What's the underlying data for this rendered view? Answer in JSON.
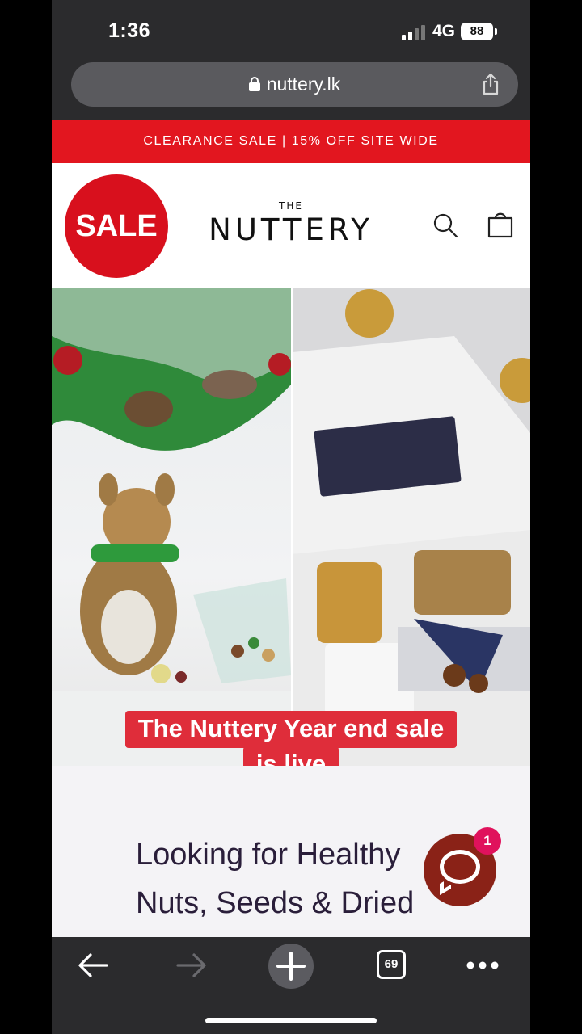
{
  "status_bar": {
    "time": "1:36",
    "network": "4G",
    "battery": "88"
  },
  "browser": {
    "url": "nuttery.lk"
  },
  "site": {
    "announcement": "CLEARANCE SALE | 15% OFF SITE WIDE",
    "sale_badge": "SALE",
    "logo_small": "THE",
    "logo_main": "NUTTERY",
    "hero_caption_line1": "The Nuttery Year end sale",
    "hero_caption_line2": "is live",
    "intro_title": "Looking for Healthy Nuts, Seeds & Dried Fruits?",
    "chat_unread": "1"
  },
  "toolbar": {
    "tabs_count": "69"
  },
  "colors": {
    "accent_red": "#e2161f",
    "caption_red": "#df2d3a",
    "chat_brown": "#8a2217",
    "badge_pink": "#e0125c"
  }
}
